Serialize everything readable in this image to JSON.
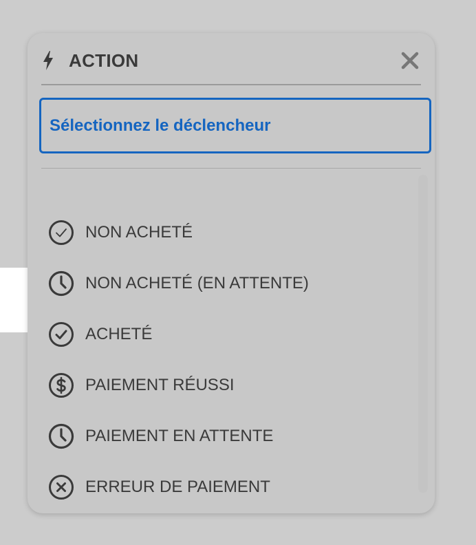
{
  "colors": {
    "backdrop": "#cccccc",
    "panel": "#c8c8c8",
    "accent": "#1565c0",
    "text": "#3a3a3a",
    "highlight": "#ffffff"
  },
  "header": {
    "icon": "bolt-icon",
    "title": "ACTION",
    "close_icon": "close-icon"
  },
  "trigger": {
    "label": "Sélectionnez le déclencheur"
  },
  "items": [
    {
      "label": "NON ACHETÉ",
      "icon": "check-circle-outline-icon"
    },
    {
      "label": "NON ACHETÉ (EN ATTENTE)",
      "icon": "clock-icon"
    },
    {
      "label": "ACHETÉ",
      "icon": "check-circle-icon",
      "highlighted": true
    },
    {
      "label": "PAIEMENT RÉUSSI",
      "icon": "dollar-circle-icon"
    },
    {
      "label": "PAIEMENT EN ATTENTE",
      "icon": "clock-icon"
    },
    {
      "label": "ERREUR DE PAIEMENT",
      "icon": "x-circle-icon"
    }
  ]
}
